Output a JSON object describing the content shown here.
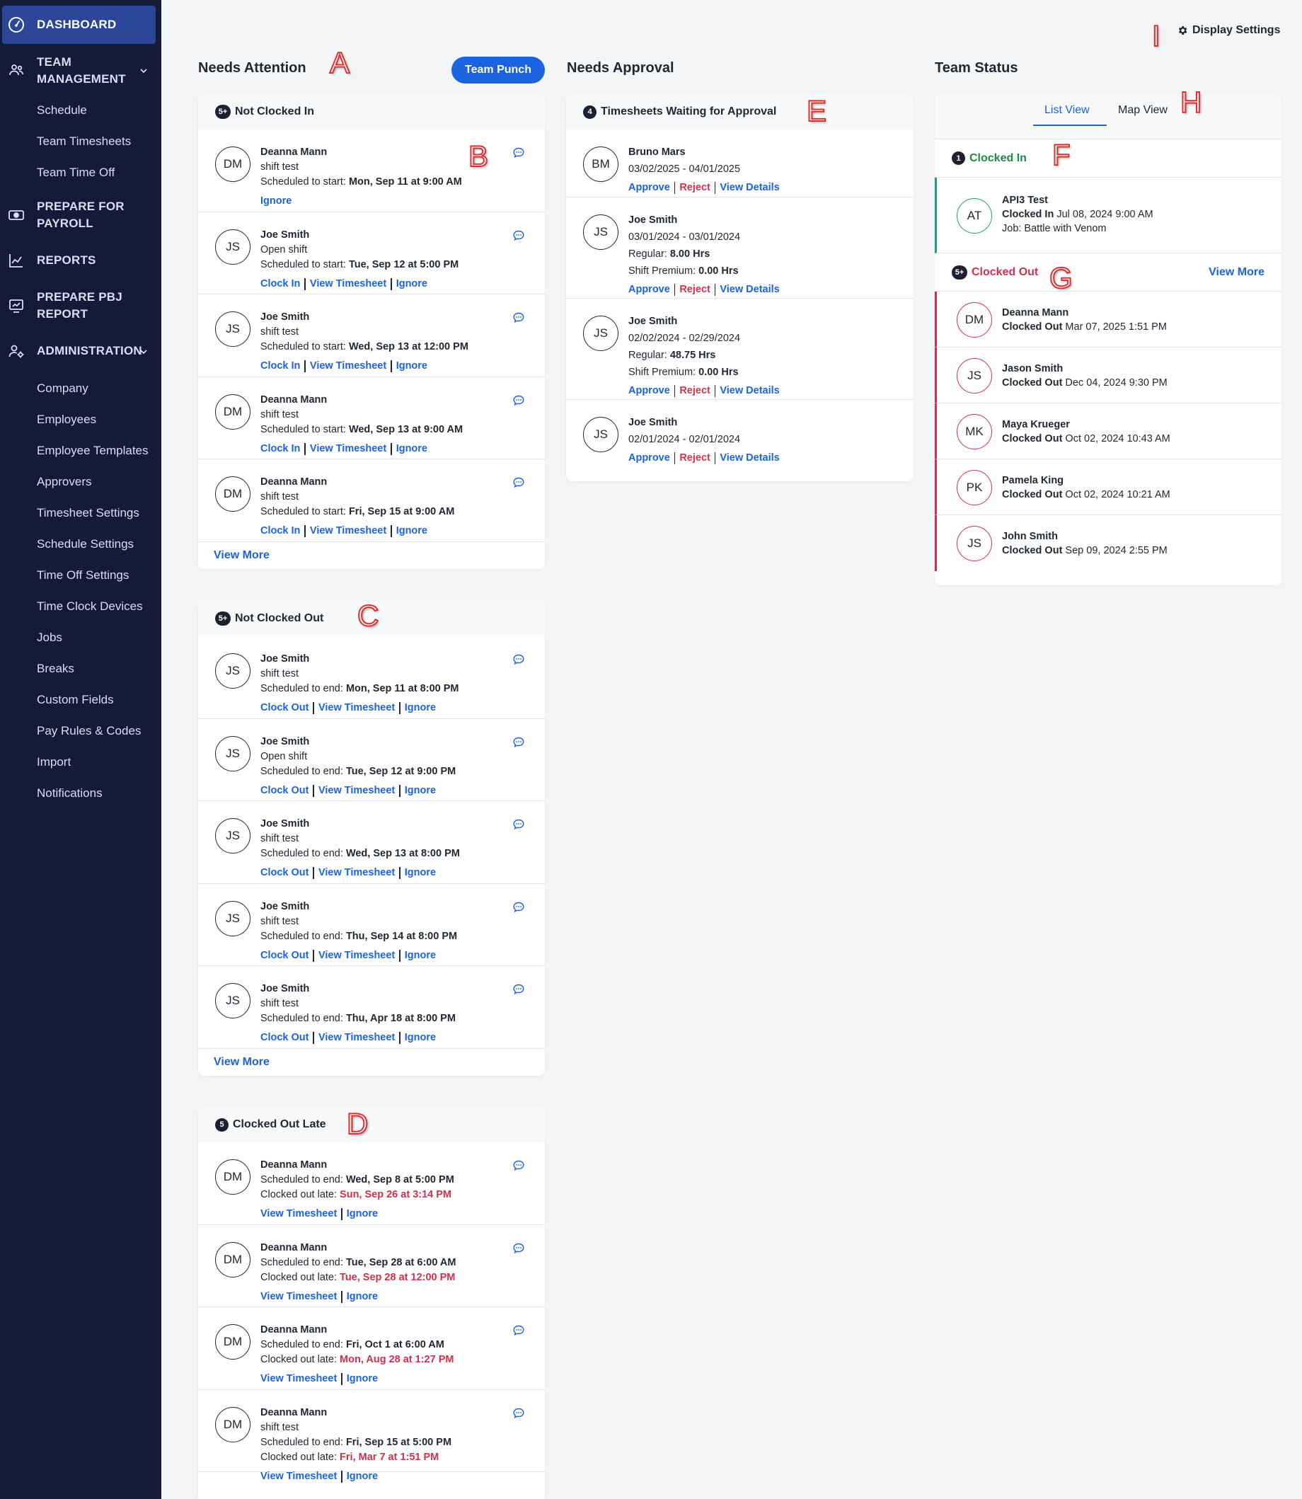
{
  "sidebar": {
    "dashboard": "DASHBOARD",
    "team_management": [
      "TEAM",
      "MANAGEMENT"
    ],
    "team_items": [
      "Schedule",
      "Team Timesheets",
      "Team Time Off"
    ],
    "prepare_payroll": [
      "PREPARE FOR",
      "PAYROLL"
    ],
    "reports": "REPORTS",
    "prepare_pbj": [
      "PREPARE PBJ",
      "REPORT"
    ],
    "administration": "ADMINISTRATION",
    "admin_items": [
      "Company",
      "Employees",
      "Employee Templates",
      "Approvers",
      "Timesheet Settings",
      "Schedule Settings",
      "Time Off Settings",
      "Time Clock Devices",
      "Jobs",
      "Breaks",
      "Custom Fields",
      "Pay Rules & Codes",
      "Import",
      "Notifications"
    ]
  },
  "header": {
    "display_settings": "Display Settings",
    "needs_attention": "Needs Attention",
    "team_punch": "Team Punch",
    "needs_approval": "Needs Approval",
    "team_status": "Team Status"
  },
  "not_clocked_in": {
    "count": "5+",
    "title": "Not Clocked In",
    "rows": [
      {
        "initials": "DM",
        "name": "Deanna Mann",
        "shift": "shift test",
        "prefix": "Scheduled to start: ",
        "time": "Mon, Sep 11 at 9:00 AM",
        "links": [
          "Ignore"
        ]
      },
      {
        "initials": "JS",
        "name": "Joe Smith",
        "shift": "Open shift",
        "prefix": "Scheduled to start: ",
        "time": "Tue, Sep 12 at 5:00 PM",
        "links": [
          "Clock In",
          "View Timesheet",
          "Ignore"
        ]
      },
      {
        "initials": "JS",
        "name": "Joe Smith",
        "shift": "shift test",
        "prefix": "Scheduled to start: ",
        "time": "Wed, Sep 13 at 12:00 PM",
        "links": [
          "Clock In",
          "View Timesheet",
          "Ignore"
        ]
      },
      {
        "initials": "DM",
        "name": "Deanna Mann",
        "shift": "shift test",
        "prefix": "Scheduled to start: ",
        "time": "Wed, Sep 13 at 9:00 AM",
        "links": [
          "Clock In",
          "View Timesheet",
          "Ignore"
        ]
      },
      {
        "initials": "DM",
        "name": "Deanna Mann",
        "shift": "shift test",
        "prefix": "Scheduled to start: ",
        "time": "Fri, Sep 15 at 9:00 AM",
        "links": [
          "Clock In",
          "View Timesheet",
          "Ignore"
        ]
      }
    ],
    "view_more": "View More"
  },
  "not_clocked_out": {
    "count": "5+",
    "title": "Not Clocked Out",
    "rows": [
      {
        "initials": "JS",
        "name": "Joe Smith",
        "shift": "shift test",
        "prefix": "Scheduled to end: ",
        "time": "Mon, Sep 11 at 8:00 PM",
        "links": [
          "Clock Out",
          "View Timesheet",
          "Ignore"
        ]
      },
      {
        "initials": "JS",
        "name": "Joe Smith",
        "shift": "Open shift",
        "prefix": "Scheduled to end: ",
        "time": "Tue, Sep 12 at 9:00 PM",
        "links": [
          "Clock Out",
          "View Timesheet",
          "Ignore"
        ]
      },
      {
        "initials": "JS",
        "name": "Joe Smith",
        "shift": "shift test",
        "prefix": "Scheduled to end: ",
        "time": "Wed, Sep 13 at 8:00 PM",
        "links": [
          "Clock Out",
          "View Timesheet",
          "Ignore"
        ]
      },
      {
        "initials": "JS",
        "name": "Joe Smith",
        "shift": "shift test",
        "prefix": "Scheduled to end: ",
        "time": "Thu, Sep 14 at 8:00 PM",
        "links": [
          "Clock Out",
          "View Timesheet",
          "Ignore"
        ]
      },
      {
        "initials": "JS",
        "name": "Joe Smith",
        "shift": "shift test",
        "prefix": "Scheduled to end: ",
        "time": "Thu, Apr 18 at 8:00 PM",
        "links": [
          "Clock Out",
          "View Timesheet",
          "Ignore"
        ]
      }
    ],
    "view_more": "View More"
  },
  "clocked_out_late": {
    "count": "5",
    "title": "Clocked Out Late",
    "late_prefix": "Clocked out late: ",
    "rows": [
      {
        "initials": "DM",
        "name": "Deanna Mann",
        "shift": "",
        "prefix": "Scheduled to end: ",
        "time": "Wed, Sep 8 at 5:00 PM",
        "late": "Sun, Sep 26 at 3:14 PM",
        "links": [
          "View Timesheet",
          "Ignore"
        ]
      },
      {
        "initials": "DM",
        "name": "Deanna Mann",
        "shift": "",
        "prefix": "Scheduled to end: ",
        "time": "Tue, Sep 28 at 6:00 AM",
        "late": "Tue, Sep 28 at 12:00 PM",
        "links": [
          "View Timesheet",
          "Ignore"
        ]
      },
      {
        "initials": "DM",
        "name": "Deanna Mann",
        "shift": "",
        "prefix": "Scheduled to end: ",
        "time": "Fri, Oct 1 at 6:00 AM",
        "late": "Mon, Aug 28 at 1:27 PM",
        "links": [
          "View Timesheet",
          "Ignore"
        ]
      },
      {
        "initials": "DM",
        "name": "Deanna Mann",
        "shift": "shift test",
        "prefix": "Scheduled to end: ",
        "time": "Fri, Sep 15 at 5:00 PM",
        "late": "Fri, Mar 7 at 1:51 PM",
        "links": [
          "View Timesheet",
          "Ignore"
        ]
      }
    ]
  },
  "approval": {
    "count": "4",
    "title": "Timesheets Waiting for Approval",
    "regular_label": "Regular: ",
    "premium_label": "Shift Premium: ",
    "links": [
      "Approve",
      "Reject",
      "View Details"
    ],
    "rows": [
      {
        "initials": "BM",
        "name": "Bruno Mars",
        "range": "03/02/2025 - 04/01/2025",
        "regular": "",
        "premium": ""
      },
      {
        "initials": "JS",
        "name": "Joe Smith",
        "range": "03/01/2024 - 03/01/2024",
        "regular": "8.00 Hrs",
        "premium": "0.00 Hrs"
      },
      {
        "initials": "JS",
        "name": "Joe Smith",
        "range": "02/02/2024 - 02/29/2024",
        "regular": "48.75 Hrs",
        "premium": "0.00 Hrs"
      },
      {
        "initials": "JS",
        "name": "Joe Smith",
        "range": "02/01/2024 - 02/01/2024",
        "regular": "",
        "premium": ""
      }
    ]
  },
  "team_status": {
    "tabs": [
      "List View",
      "Map View"
    ],
    "clocked_in": {
      "count": "1",
      "title": "Clocked In",
      "rows": [
        {
          "initials": "AT",
          "name": "API3 Test",
          "label": "Clocked In",
          "time": " Jul 08, 2024 9:00 AM",
          "job": "Job: Battle with Venom"
        }
      ]
    },
    "clocked_out": {
      "count": "5+",
      "title": "Clocked Out",
      "view_more": "View More",
      "rows": [
        {
          "initials": "DM",
          "name": "Deanna Mann",
          "label": "Clocked Out",
          "time": " Mar 07, 2025 1:51 PM"
        },
        {
          "initials": "JS",
          "name": "Jason Smith",
          "label": "Clocked Out",
          "time": " Dec 04, 2024 9:30 PM"
        },
        {
          "initials": "MK",
          "name": "Maya Krueger",
          "label": "Clocked Out",
          "time": " Oct 02, 2024 10:43 AM"
        },
        {
          "initials": "PK",
          "name": "Pamela King",
          "label": "Clocked Out",
          "time": " Oct 02, 2024 10:21 AM"
        },
        {
          "initials": "JS",
          "name": "John Smith",
          "label": "Clocked Out",
          "time": " Sep 09, 2024 2:55 PM"
        }
      ]
    }
  },
  "annotations": [
    "A",
    "B",
    "C",
    "D",
    "E",
    "F",
    "G",
    "H",
    "I"
  ],
  "colors": {
    "sidebar": "#141b38",
    "active_nav": "#2b4597",
    "accent": "#1b63e0",
    "danger": "#d32f4c",
    "success": "#1f8a4c"
  }
}
